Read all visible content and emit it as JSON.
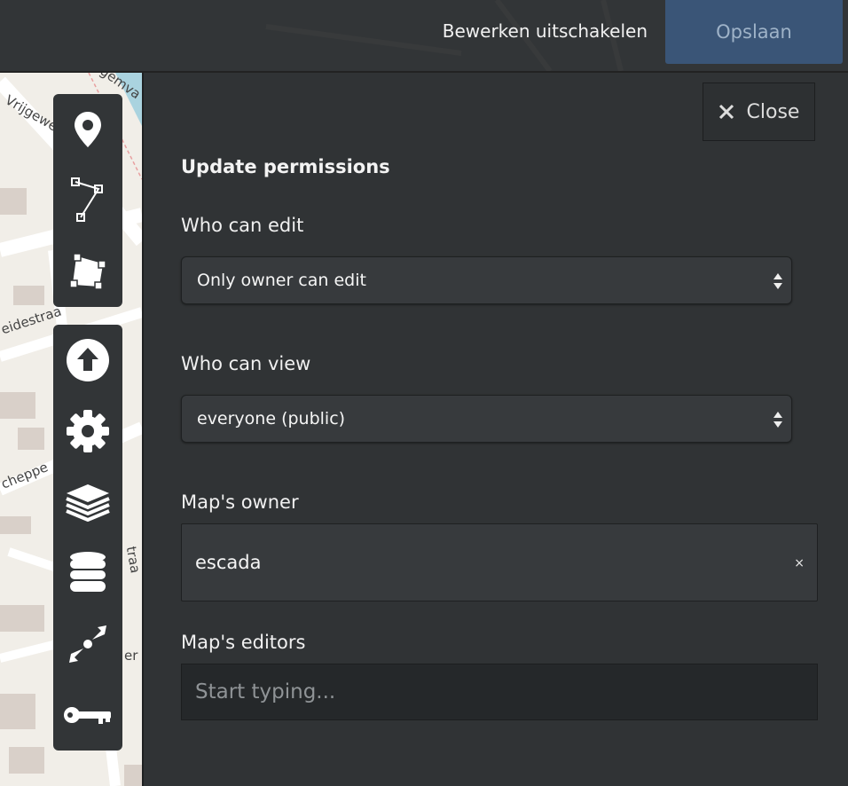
{
  "topbar": {
    "edit_toggle_label": "Bewerken uitschakelen",
    "save_label": "Opslaan"
  },
  "map": {
    "street_labels": [
      "Vrijgeweid",
      "gemva",
      "eidestraa",
      "cheppe",
      "traa",
      "er"
    ]
  },
  "toolbar_draw": {
    "items": [
      {
        "icon": "marker-icon"
      },
      {
        "icon": "polyline-icon"
      },
      {
        "icon": "polygon-icon"
      }
    ]
  },
  "toolbar_settings": {
    "items": [
      {
        "icon": "upload-icon"
      },
      {
        "icon": "gear-icon"
      },
      {
        "icon": "layers-icon"
      },
      {
        "icon": "database-icon"
      },
      {
        "icon": "center-map-icon"
      },
      {
        "icon": "key-icon"
      }
    ]
  },
  "panel": {
    "close_label": "Close",
    "title": "Update permissions",
    "who_can_edit": {
      "label": "Who can edit",
      "value": "Only owner can edit"
    },
    "who_can_view": {
      "label": "Who can view",
      "value": "everyone (public)"
    },
    "owner": {
      "label": "Map's owner",
      "value": "escada",
      "remove_symbol": "×"
    },
    "editors": {
      "label": "Map's editors",
      "placeholder": "Start typing..."
    }
  },
  "colors": {
    "panel_bg": "#303335",
    "save_bg": "#3a5577",
    "toolbar_bg": "#323537",
    "map_bg": "#f1eee8"
  }
}
